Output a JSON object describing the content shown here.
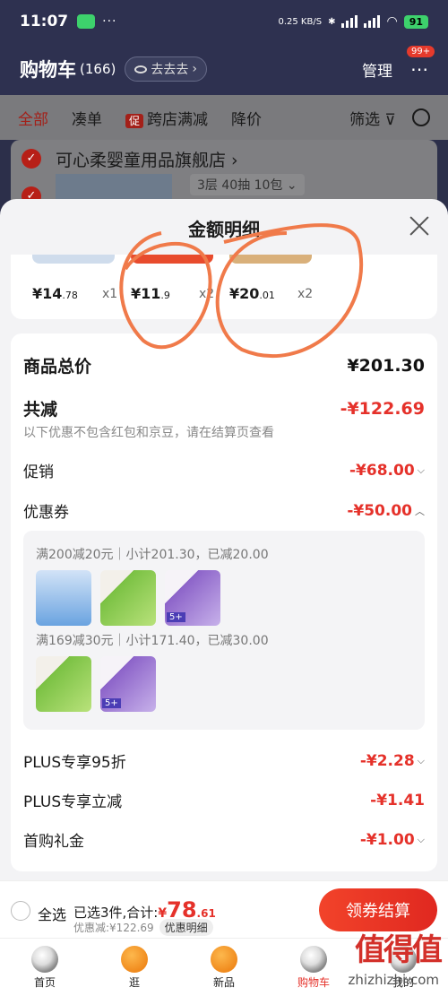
{
  "status_bar": {
    "time": "11:07",
    "dots": "···",
    "speed": "0.25 KB/S",
    "battery": "91"
  },
  "header": {
    "title": "购物车",
    "count": "(166)",
    "browse_label": "去去去",
    "manage_label": "管理",
    "message_badge": "99+"
  },
  "filters": {
    "all": "全部",
    "bundle": "凑单",
    "promo_tag": "促",
    "cross_store": "跨店满减",
    "price_drop": "降价",
    "filter": "筛选"
  },
  "store": {
    "name": "可心柔婴童用品旗舰店",
    "spec": "3层 40抽 10包"
  },
  "sheet": {
    "title": "金额明细",
    "goods": [
      {
        "price_int": "¥14",
        "price_dec": ".78",
        "qty": "x1",
        "color": "#cfdcec"
      },
      {
        "price_int": "¥11",
        "price_dec": ".9",
        "qty": "x2",
        "color": "#e84b2d"
      },
      {
        "price_int": "¥20",
        "price_dec": ".01",
        "qty": "x2",
        "color": "#d9b07a"
      }
    ]
  },
  "details": {
    "total_label": "商品总价",
    "total_amount": "¥201.30",
    "reduce_label": "共减",
    "reduce_amount": "-¥122.69",
    "note": "以下优惠不包含红包和京豆，请在结算页查看",
    "promo_label": "促销",
    "promo_amount": "-¥68.00",
    "coupon_label": "优惠券",
    "coupon_amount": "-¥50.00",
    "coupon_line1": "满200减20元｜小计201.30，已减20.00",
    "coupon_line2": "满169减30元｜小计171.40，已减30.00",
    "plus95_label": "PLUS专享95折",
    "plus95_amount": "-¥2.28",
    "plus_direct_label": "PLUS专享立减",
    "plus_direct_amount": "-¥1.41",
    "first_gift_label": "首购礼金",
    "first_gift_amount": "-¥1.00",
    "badge_5": "5+"
  },
  "bottom": {
    "select_all": "全选",
    "selected_text": "已选3件,合计:",
    "currency": "¥",
    "total_int": "78",
    "total_dec": ".61",
    "discount_text": "优惠减:¥122.69",
    "detail_pill": "优惠明细",
    "checkout": "领券结算"
  },
  "tabs": [
    {
      "label": "首页"
    },
    {
      "label": "逛"
    },
    {
      "label": "新品"
    },
    {
      "label": "购物车"
    },
    {
      "label": "我的"
    }
  ],
  "watermark": {
    "text": "值得值",
    "url": "zhizhizhi.com"
  }
}
